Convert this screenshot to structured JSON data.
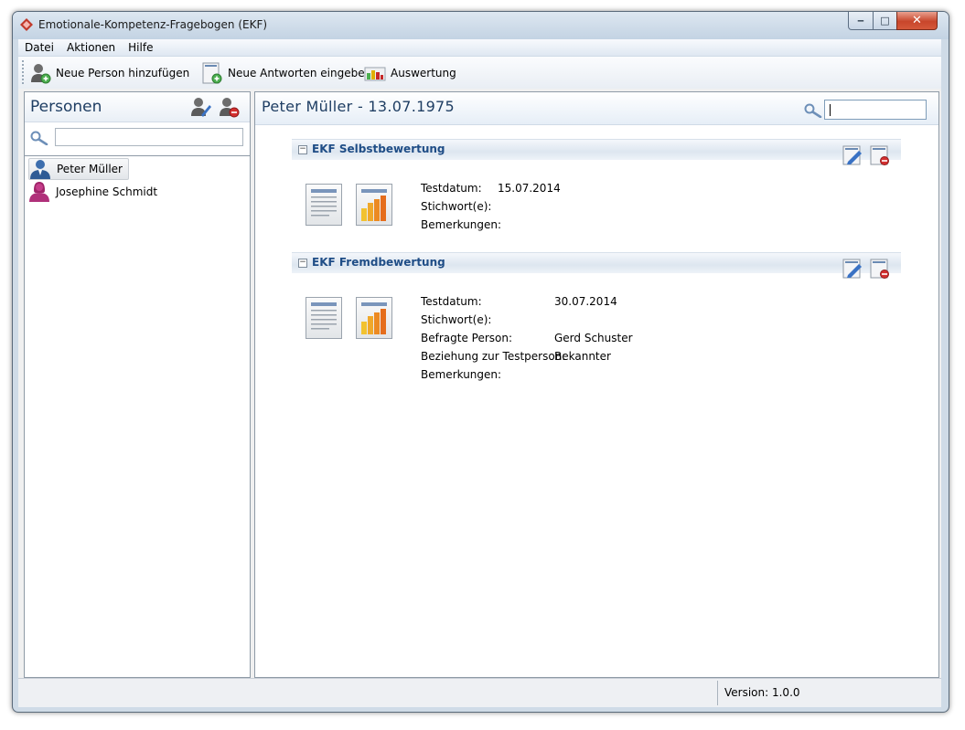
{
  "window": {
    "title": "Emotionale-Kompetenz-Fragebogen (EKF)",
    "controls": {
      "minimize": "‒",
      "maximize": "□",
      "close": "✕"
    }
  },
  "menu": {
    "items": [
      "Datei",
      "Aktionen",
      "Hilfe"
    ]
  },
  "toolbar": {
    "add_person": "Neue Person hinzufügen",
    "new_answers": "Neue Antworten eingeben",
    "evaluation": "Auswertung"
  },
  "persons_panel": {
    "title": "Personen",
    "search_value": "",
    "persons": [
      {
        "name": "Peter Müller",
        "gender": "male",
        "selected": true
      },
      {
        "name": "Josephine Schmidt",
        "gender": "female",
        "selected": false
      }
    ]
  },
  "detail": {
    "title": "Peter Müller - 13.07.1975",
    "search_value": "",
    "sections": [
      {
        "title": "EKF Selbstbewertung",
        "collapse_glyph": "−",
        "fields": [
          {
            "label": "Testdatum:",
            "value": "15.07.2014"
          },
          {
            "label": "Stichwort(e):",
            "value": ""
          },
          {
            "label": "Bemerkungen:",
            "value": ""
          }
        ]
      },
      {
        "title": "EKF Fremdbewertung",
        "collapse_glyph": "−",
        "fields": [
          {
            "label": "Testdatum:",
            "value": "30.07.2014"
          },
          {
            "label": "Stichwort(e):",
            "value": ""
          },
          {
            "label": "Befragte Person:",
            "value": "Gerd Schuster"
          },
          {
            "label": "Beziehung zur Testperson:",
            "value": "Bekannter"
          },
          {
            "label": "Bemerkungen:",
            "value": ""
          }
        ]
      }
    ]
  },
  "status": {
    "version": "Version: 1.0.0"
  },
  "colors": {
    "accent_text": "#1f3e63",
    "section_title": "#1f4d86",
    "close_button": "#c8462b"
  }
}
